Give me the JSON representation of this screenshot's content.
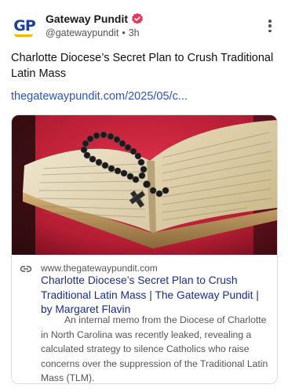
{
  "author": {
    "avatar_text": "GP",
    "name": "Gateway Pundit",
    "handle": "@gatewaypundit",
    "separator": "•",
    "time": "3h"
  },
  "post": {
    "title": "Charlotte Diocese’s Secret Plan to Crush Traditional Latin Mass",
    "link": "thegatewaypundit.com/2025/05/c..."
  },
  "card": {
    "domain": "www.thegatewaypundit.com",
    "title": "Charlotte Diocese’s Secret Plan to Crush Traditional Latin Mass | The Gateway Pundit | by Margaret Flavin",
    "description": "An internal memo from the Diocese of Charlotte in North Carolina was recently leaked, revealing a calculated strategy to silence Catholics who raise concerns over the suppression of the Traditional Latin Mass (TLM)."
  },
  "icons": {
    "verified": "verified-badge-icon",
    "more": "more-options-icon",
    "link": "link-icon"
  },
  "colors": {
    "verified_badge": "#e8335a",
    "link_text": "#2b55c7",
    "card_title": "#1a2d8c",
    "avatar_blue": "#1e3f9a",
    "avatar_gold": "#f2b800"
  }
}
